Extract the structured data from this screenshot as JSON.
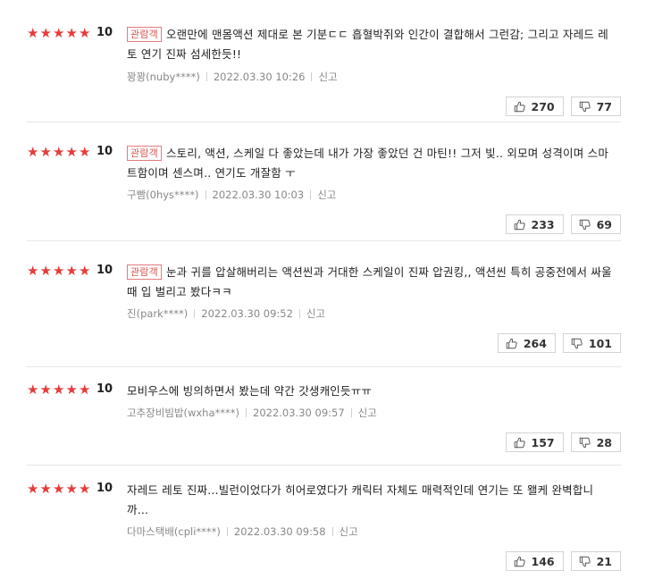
{
  "reviews": [
    {
      "score": "10",
      "badge": "관람객",
      "text": "오랜만에 맨몸액션 제대로 본 기분ㄷㄷ 흡혈박쥐와 인간이 결합해서 그런감; 그리고 자레드 레토 연기 진짜 섬세한듯!!",
      "author": "꽝꽝(nuby****)",
      "date": "2022.03.30 10:26",
      "report": "신고",
      "likes": "270",
      "dislikes": "77"
    },
    {
      "score": "10",
      "badge": "관람객",
      "text": "스토리, 액션, 스케일 다 좋았는데 내가 가장 좋았던 건 마틴!! 그저 빛.. 외모며 성격이며 스마트함이며 센스며.. 연기도 개잘함 ㅜ",
      "author": "구빰(0hys****)",
      "date": "2022.03.30 10:03",
      "report": "신고",
      "likes": "233",
      "dislikes": "69"
    },
    {
      "score": "10",
      "badge": "관람객",
      "text": "눈과 귀를 압살해버리는 액션씬과 거대한 스케일이 진짜 압권킹,, 액션씬 특히 공중전에서 싸울때 입 벌리고 봤다ㅋㅋ",
      "author": "진(park****)",
      "date": "2022.03.30 09:52",
      "report": "신고",
      "likes": "264",
      "dislikes": "101"
    },
    {
      "score": "10",
      "badge": "",
      "text": "모비우스에 빙의하면서 봤는데 약간 갓생캐인듯ㅠㅠ",
      "author": "고추장비빔밥(wxha****)",
      "date": "2022.03.30 09:57",
      "report": "신고",
      "likes": "157",
      "dislikes": "28"
    },
    {
      "score": "10",
      "badge": "",
      "text": "자레드 레토 진짜...빌런이었다가 히어로였다가 캐릭터 자체도 매력적인데 연기는 또 왤케 완벽합니까...",
      "author": "다마스택배(cpli****)",
      "date": "2022.03.30 09:58",
      "report": "신고",
      "likes": "146",
      "dislikes": "21"
    }
  ]
}
